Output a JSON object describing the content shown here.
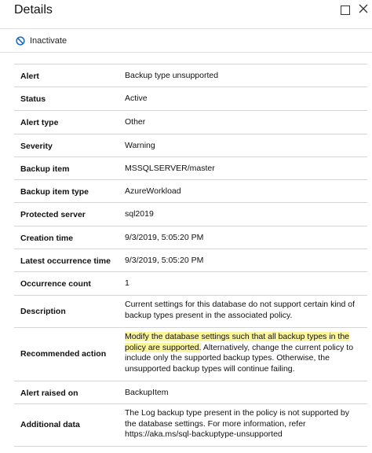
{
  "header": {
    "title": "Details"
  },
  "toolbar": {
    "inactivate_label": "Inactivate"
  },
  "details": [
    {
      "label": "Alert",
      "value": "Backup type unsupported"
    },
    {
      "label": "Status",
      "value": "Active"
    },
    {
      "label": "Alert type",
      "value": "Other"
    },
    {
      "label": "Severity",
      "value": "Warning"
    },
    {
      "label": "Backup item",
      "value": "MSSQLSERVER/master"
    },
    {
      "label": "Backup item type",
      "value": "AzureWorkload"
    },
    {
      "label": "Protected server",
      "value": "sql2019"
    },
    {
      "label": "Creation time",
      "value": "9/3/2019, 5:05:20 PM"
    },
    {
      "label": "Latest occurrence time",
      "value": "9/3/2019, 5:05:20 PM"
    },
    {
      "label": "Occurrence count",
      "value": "1"
    },
    {
      "label": "Description",
      "value": "Current settings for this database do not support certain kind of backup types present in the associated policy."
    },
    {
      "label": "Recommended action",
      "value_highlighted": "Modify the database settings such that all backup types in the policy are supported.",
      "value_rest": " Alternatively, change the current policy to include only the supported backup types. Otherwise, the unsupported backup types will continue failing."
    },
    {
      "label": "Alert raised on",
      "value": "BackupItem"
    },
    {
      "label": "Additional data",
      "value": "The Log backup type present in the policy is not supported by the database settings. For more information, refer https://aka.ms/sql-backuptype-unsupported"
    }
  ],
  "colors": {
    "highlight": "#fbf59b",
    "inactivate_icon": "#1e6fc1",
    "row_divider": "#d5d5d5"
  }
}
